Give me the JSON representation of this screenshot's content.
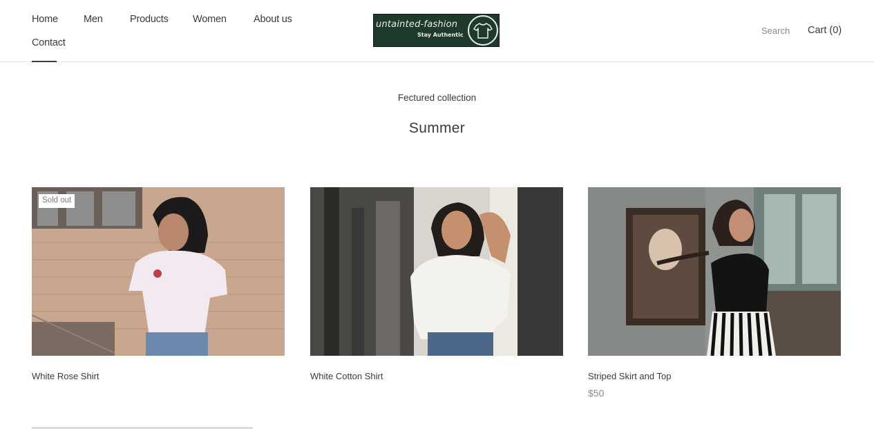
{
  "nav": {
    "home": "Home",
    "men": "Men",
    "products": "Products",
    "women": "Women",
    "about": "About us",
    "contact": "Contact"
  },
  "logo": {
    "wordmark": "untainted-fashion",
    "tagline": "Stay Authentic",
    "icon": "t-shirt-icon"
  },
  "header_actions": {
    "search": "Search",
    "cart": "Cart (0)"
  },
  "collection": {
    "eyebrow": "Fectured collection",
    "title": "Summer"
  },
  "products": [
    {
      "name": "White Rose Shirt",
      "badge": "Sold out",
      "price": ""
    },
    {
      "name": "White Cotton Shirt",
      "badge": "",
      "price": ""
    },
    {
      "name": "Striped Skirt and Top",
      "badge": "",
      "price": "$50"
    }
  ],
  "colors": {
    "text": "#3a3a3a",
    "muted": "#8a8a8a",
    "logo_bg": "#1f3a2a"
  }
}
